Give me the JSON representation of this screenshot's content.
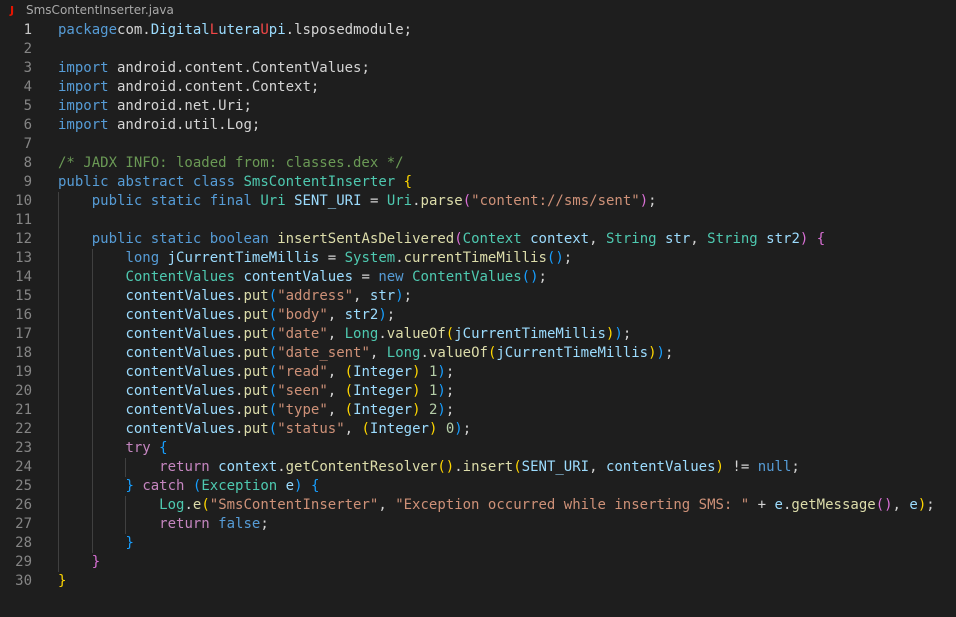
{
  "tab": {
    "icon": "java-file-icon",
    "icon_glyph": "J",
    "filename": "SmsContentInserter.java"
  },
  "editor": {
    "active_line": 1,
    "lines": [
      {
        "n": "1",
        "i": 0,
        "t": [
          [
            "kw",
            "package"
          ],
          [
            "",
            "com."
          ],
          [
            "var",
            "Digital"
          ],
          [
            "red",
            "L"
          ],
          [
            "var",
            "utera"
          ],
          [
            "red",
            "U"
          ],
          [
            "var",
            "pi"
          ],
          [
            "",
            ".lsposedmodule;"
          ]
        ]
      },
      {
        "n": "2",
        "i": 0,
        "t": []
      },
      {
        "n": "3",
        "i": 0,
        "t": [
          [
            "kw",
            "import"
          ],
          [
            "",
            " android.content.ContentValues;"
          ]
        ]
      },
      {
        "n": "4",
        "i": 0,
        "t": [
          [
            "kw",
            "import"
          ],
          [
            "",
            " android.content.Context;"
          ]
        ]
      },
      {
        "n": "5",
        "i": 0,
        "t": [
          [
            "kw",
            "import"
          ],
          [
            "",
            " android.net.Uri;"
          ]
        ]
      },
      {
        "n": "6",
        "i": 0,
        "t": [
          [
            "kw",
            "import"
          ],
          [
            "",
            " android.util.Log;"
          ]
        ]
      },
      {
        "n": "7",
        "i": 0,
        "t": []
      },
      {
        "n": "8",
        "i": 0,
        "t": [
          [
            "cmt",
            "/* JADX INFO: loaded from: classes.dex */"
          ]
        ]
      },
      {
        "n": "9",
        "i": 0,
        "t": [
          [
            "kw",
            "public"
          ],
          [
            "",
            " "
          ],
          [
            "kw",
            "abstract"
          ],
          [
            "",
            " "
          ],
          [
            "kw",
            "class"
          ],
          [
            "",
            " "
          ],
          [
            "ty",
            "SmsContentInserter"
          ],
          [
            "",
            " "
          ],
          [
            "b1",
            "{"
          ]
        ]
      },
      {
        "n": "10",
        "i": 1,
        "t": [
          [
            "kw",
            "public"
          ],
          [
            "",
            " "
          ],
          [
            "kw",
            "static"
          ],
          [
            "",
            " "
          ],
          [
            "kw",
            "final"
          ],
          [
            "",
            " "
          ],
          [
            "ty",
            "Uri"
          ],
          [
            "",
            " "
          ],
          [
            "var",
            "SENT_URI"
          ],
          [
            "",
            " = "
          ],
          [
            "ty",
            "Uri"
          ],
          [
            "",
            "."
          ],
          [
            "fn",
            "parse"
          ],
          [
            "b2",
            "("
          ],
          [
            "str",
            "\"content://sms/sent\""
          ],
          [
            "b2",
            ")"
          ],
          [
            "",
            ";"
          ]
        ]
      },
      {
        "n": "11",
        "i": 1,
        "t": []
      },
      {
        "n": "12",
        "i": 1,
        "t": [
          [
            "kw",
            "public"
          ],
          [
            "",
            " "
          ],
          [
            "kw",
            "static"
          ],
          [
            "",
            " "
          ],
          [
            "kw",
            "boolean"
          ],
          [
            "",
            " "
          ],
          [
            "fn",
            "insertSentAsDelivered"
          ],
          [
            "b2",
            "("
          ],
          [
            "ty",
            "Context"
          ],
          [
            "",
            " "
          ],
          [
            "var",
            "context"
          ],
          [
            "",
            ", "
          ],
          [
            "ty",
            "String"
          ],
          [
            "",
            " "
          ],
          [
            "var",
            "str"
          ],
          [
            "",
            ", "
          ],
          [
            "ty",
            "String"
          ],
          [
            "",
            " "
          ],
          [
            "var",
            "str2"
          ],
          [
            "b2",
            ")"
          ],
          [
            "",
            " "
          ],
          [
            "b2",
            "{"
          ]
        ]
      },
      {
        "n": "13",
        "i": 2,
        "t": [
          [
            "kw",
            "long"
          ],
          [
            "",
            " "
          ],
          [
            "var",
            "jCurrentTimeMillis"
          ],
          [
            "",
            " = "
          ],
          [
            "ty",
            "System"
          ],
          [
            "",
            "."
          ],
          [
            "fn",
            "currentTimeMillis"
          ],
          [
            "b3",
            "()"
          ],
          [
            "",
            ";"
          ]
        ]
      },
      {
        "n": "14",
        "i": 2,
        "t": [
          [
            "ty",
            "ContentValues"
          ],
          [
            "",
            " "
          ],
          [
            "var",
            "contentValues"
          ],
          [
            "",
            " = "
          ],
          [
            "kw",
            "new"
          ],
          [
            "",
            " "
          ],
          [
            "ty",
            "ContentValues"
          ],
          [
            "b3",
            "()"
          ],
          [
            "",
            ";"
          ]
        ]
      },
      {
        "n": "15",
        "i": 2,
        "t": [
          [
            "var",
            "contentValues"
          ],
          [
            "",
            "."
          ],
          [
            "fn",
            "put"
          ],
          [
            "b3",
            "("
          ],
          [
            "str",
            "\"address\""
          ],
          [
            "",
            ", "
          ],
          [
            "var",
            "str"
          ],
          [
            "b3",
            ")"
          ],
          [
            "",
            ";"
          ]
        ]
      },
      {
        "n": "16",
        "i": 2,
        "t": [
          [
            "var",
            "contentValues"
          ],
          [
            "",
            "."
          ],
          [
            "fn",
            "put"
          ],
          [
            "b3",
            "("
          ],
          [
            "str",
            "\"body\""
          ],
          [
            "",
            ", "
          ],
          [
            "var",
            "str2"
          ],
          [
            "b3",
            ")"
          ],
          [
            "",
            ";"
          ]
        ]
      },
      {
        "n": "17",
        "i": 2,
        "t": [
          [
            "var",
            "contentValues"
          ],
          [
            "",
            "."
          ],
          [
            "fn",
            "put"
          ],
          [
            "b3",
            "("
          ],
          [
            "str",
            "\"date\""
          ],
          [
            "",
            ", "
          ],
          [
            "ty",
            "Long"
          ],
          [
            "",
            "."
          ],
          [
            "fn",
            "valueOf"
          ],
          [
            "b1",
            "("
          ],
          [
            "var",
            "jCurrentTimeMillis"
          ],
          [
            "b1",
            ")"
          ],
          [
            "b3",
            ")"
          ],
          [
            "",
            ";"
          ]
        ]
      },
      {
        "n": "18",
        "i": 2,
        "t": [
          [
            "var",
            "contentValues"
          ],
          [
            "",
            "."
          ],
          [
            "fn",
            "put"
          ],
          [
            "b3",
            "("
          ],
          [
            "str",
            "\"date_sent\""
          ],
          [
            "",
            ", "
          ],
          [
            "ty",
            "Long"
          ],
          [
            "",
            "."
          ],
          [
            "fn",
            "valueOf"
          ],
          [
            "b1",
            "("
          ],
          [
            "var",
            "jCurrentTimeMillis"
          ],
          [
            "b1",
            ")"
          ],
          [
            "b3",
            ")"
          ],
          [
            "",
            ";"
          ]
        ]
      },
      {
        "n": "19",
        "i": 2,
        "t": [
          [
            "var",
            "contentValues"
          ],
          [
            "",
            "."
          ],
          [
            "fn",
            "put"
          ],
          [
            "b3",
            "("
          ],
          [
            "str",
            "\"read\""
          ],
          [
            "",
            ", "
          ],
          [
            "b1",
            "("
          ],
          [
            "var",
            "Integer"
          ],
          [
            "b1",
            ")"
          ],
          [
            "",
            " "
          ],
          [
            "num",
            "1"
          ],
          [
            "b3",
            ")"
          ],
          [
            "",
            ";"
          ]
        ]
      },
      {
        "n": "20",
        "i": 2,
        "t": [
          [
            "var",
            "contentValues"
          ],
          [
            "",
            "."
          ],
          [
            "fn",
            "put"
          ],
          [
            "b3",
            "("
          ],
          [
            "str",
            "\"seen\""
          ],
          [
            "",
            ", "
          ],
          [
            "b1",
            "("
          ],
          [
            "var",
            "Integer"
          ],
          [
            "b1",
            ")"
          ],
          [
            "",
            " "
          ],
          [
            "num",
            "1"
          ],
          [
            "b3",
            ")"
          ],
          [
            "",
            ";"
          ]
        ]
      },
      {
        "n": "21",
        "i": 2,
        "t": [
          [
            "var",
            "contentValues"
          ],
          [
            "",
            "."
          ],
          [
            "fn",
            "put"
          ],
          [
            "b3",
            "("
          ],
          [
            "str",
            "\"type\""
          ],
          [
            "",
            ", "
          ],
          [
            "b1",
            "("
          ],
          [
            "var",
            "Integer"
          ],
          [
            "b1",
            ")"
          ],
          [
            "",
            " "
          ],
          [
            "num",
            "2"
          ],
          [
            "b3",
            ")"
          ],
          [
            "",
            ";"
          ]
        ]
      },
      {
        "n": "22",
        "i": 2,
        "t": [
          [
            "var",
            "contentValues"
          ],
          [
            "",
            "."
          ],
          [
            "fn",
            "put"
          ],
          [
            "b3",
            "("
          ],
          [
            "str",
            "\"status\""
          ],
          [
            "",
            ", "
          ],
          [
            "b1",
            "("
          ],
          [
            "var",
            "Integer"
          ],
          [
            "b1",
            ")"
          ],
          [
            "",
            " "
          ],
          [
            "num",
            "0"
          ],
          [
            "b3",
            ")"
          ],
          [
            "",
            ";"
          ]
        ]
      },
      {
        "n": "23",
        "i": 2,
        "t": [
          [
            "ct",
            "try"
          ],
          [
            "",
            " "
          ],
          [
            "b3",
            "{"
          ]
        ]
      },
      {
        "n": "24",
        "i": 3,
        "t": [
          [
            "ct",
            "return"
          ],
          [
            "",
            " "
          ],
          [
            "var",
            "context"
          ],
          [
            "",
            "."
          ],
          [
            "fn",
            "getContentResolver"
          ],
          [
            "b1",
            "()"
          ],
          [
            "",
            "."
          ],
          [
            "fn",
            "insert"
          ],
          [
            "b1",
            "("
          ],
          [
            "var",
            "SENT_URI"
          ],
          [
            "",
            ", "
          ],
          [
            "var",
            "contentValues"
          ],
          [
            "b1",
            ")"
          ],
          [
            "",
            " != "
          ],
          [
            "kw",
            "null"
          ],
          [
            "",
            ";"
          ]
        ]
      },
      {
        "n": "25",
        "i": 2,
        "t": [
          [
            "b3",
            "}"
          ],
          [
            "",
            " "
          ],
          [
            "ct",
            "catch"
          ],
          [
            "",
            " "
          ],
          [
            "b3",
            "("
          ],
          [
            "ty",
            "Exception"
          ],
          [
            "",
            " "
          ],
          [
            "var",
            "e"
          ],
          [
            "b3",
            ")"
          ],
          [
            "",
            " "
          ],
          [
            "b3",
            "{"
          ]
        ]
      },
      {
        "n": "26",
        "i": 3,
        "t": [
          [
            "ty",
            "Log"
          ],
          [
            "",
            "."
          ],
          [
            "fn",
            "e"
          ],
          [
            "b1",
            "("
          ],
          [
            "str",
            "\"SmsContentInserter\""
          ],
          [
            "",
            ", "
          ],
          [
            "str",
            "\"Exception occurred while inserting SMS: \""
          ],
          [
            "",
            " + "
          ],
          [
            "var",
            "e"
          ],
          [
            "",
            "."
          ],
          [
            "fn",
            "getMessage"
          ],
          [
            "b2",
            "()"
          ],
          [
            "",
            ", "
          ],
          [
            "var",
            "e"
          ],
          [
            "b1",
            ")"
          ],
          [
            "",
            ";"
          ]
        ]
      },
      {
        "n": "27",
        "i": 3,
        "t": [
          [
            "ct",
            "return"
          ],
          [
            "",
            " "
          ],
          [
            "kw",
            "false"
          ],
          [
            "",
            ";"
          ]
        ]
      },
      {
        "n": "28",
        "i": 2,
        "t": [
          [
            "b3",
            "}"
          ]
        ]
      },
      {
        "n": "29",
        "i": 1,
        "t": [
          [
            "b2",
            "}"
          ]
        ]
      },
      {
        "n": "30",
        "i": 0,
        "t": [
          [
            "b1",
            "}"
          ]
        ]
      }
    ]
  }
}
